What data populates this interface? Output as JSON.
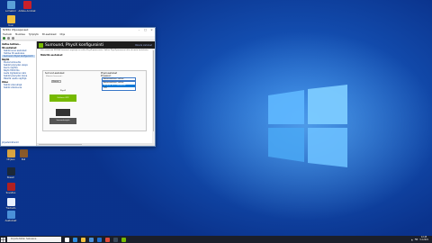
{
  "desktop": {
    "icons": [
      {
        "label": "Lomakori",
        "color": "#5aa0d8",
        "name": "recycle-bin-icon"
      },
      {
        "label": "Adobe Acrobat",
        "color": "#c8202a",
        "name": "acrobat-icon"
      },
      {
        "label": "Uusi",
        "color": "#f0c040",
        "name": "folder-icon"
      },
      {
        "label": "Uusi teksti",
        "color": "#e8e8e8",
        "name": "text-file-icon"
      },
      {
        "label": "Ohjelmat",
        "color": "#3a7bd5",
        "name": "programs-icon"
      },
      {
        "label": "Ohjaus",
        "color": "#d9a441",
        "name": "shortcut-icon"
      },
      {
        "label": "Steam",
        "color": "#1b2838",
        "name": "steam-icon"
      },
      {
        "label": "Peli",
        "color": "#8a5a2a",
        "name": "game-icon"
      },
      {
        "label": "Sovellus",
        "color": "#b02020",
        "name": "app-icon"
      },
      {
        "label": "Tiedosto",
        "color": "#e8f0ff",
        "name": "file-icon"
      },
      {
        "label": "Asetukset",
        "color": "#4a90d9",
        "name": "settings-shortcut-icon"
      }
    ]
  },
  "window": {
    "title": "NVIDIA Ohjauspaneeli",
    "menu": [
      "Tiedosto",
      "Muokkaa",
      "Työpöytä",
      "3D-asetukset",
      "Ohje"
    ],
    "nav": {
      "header": "Valitse tehtävä...",
      "groups": [
        {
          "title": "3D-asetukset",
          "items": [
            "Säädä kuvan asetukset",
            "Hallitse 3D-asetuksia",
            "Surround, PhysX konfigurointi"
          ]
        },
        {
          "title": "Näyttö",
          "items": [
            "Muuta tarkkuutta",
            "Säädä työpöydän värejä",
            "Kierrä näyttöä",
            "Näytä HDCP-tila",
            "Aseta digitaalinen ääni",
            "Säädä työpöydän kokoa",
            "Määritä useita näyttöjä"
          ]
        },
        {
          "title": "Video",
          "items": [
            "Säädä videovärejä",
            "Säädä videokuvaa"
          ]
        }
      ],
      "selected": "Surround, PhysX konfigurointi",
      "system_info": "Järjestelmätiedot"
    },
    "page_title": "Surround, PhysX konfigurointi",
    "restore_defaults": "Palauta oletukset",
    "description": "Voit määrittää NVIDIA Surround -näyttöjä tai valita PhysX-prosessorin. Valitse PhysX-prosessori alla olevasta luettelosta.",
    "section": "Määritä asetukset",
    "col1_label": "Surround-asetukset",
    "col1_check": "Määritä Surround...",
    "col1_button": "Määritä...",
    "col2_label": "PhysX-asetukset",
    "col2_sub": "Prosessori:",
    "dropdown_value": "Automaattinen valinta",
    "dropdown_options": [
      "Automaattinen valinta",
      "GeForce GTX (suositeltu)",
      "CPU"
    ],
    "dropdown_selected_index": 1,
    "gpu_caption": "PhysX",
    "gpu_label": "GeForce GTX",
    "monitor_label": "Surround-näyttö"
  },
  "taskbar": {
    "search_placeholder": "Kirjoita tähän hakusana",
    "time": "12.45",
    "date": "3.4.2021",
    "lang": "FIN",
    "apps": [
      {
        "name": "task-view-icon",
        "color": "#ffffff"
      },
      {
        "name": "edge-icon",
        "color": "#2d8de0"
      },
      {
        "name": "explorer-icon",
        "color": "#f0c040"
      },
      {
        "name": "store-icon",
        "color": "#4a90d9"
      },
      {
        "name": "mail-icon",
        "color": "#1e6fd0"
      },
      {
        "name": "chrome-icon",
        "color": "#e04a3a"
      },
      {
        "name": "steam-taskbar-icon",
        "color": "#3a4a5a"
      },
      {
        "name": "nvidia-taskbar-icon",
        "color": "#76b900"
      }
    ]
  }
}
